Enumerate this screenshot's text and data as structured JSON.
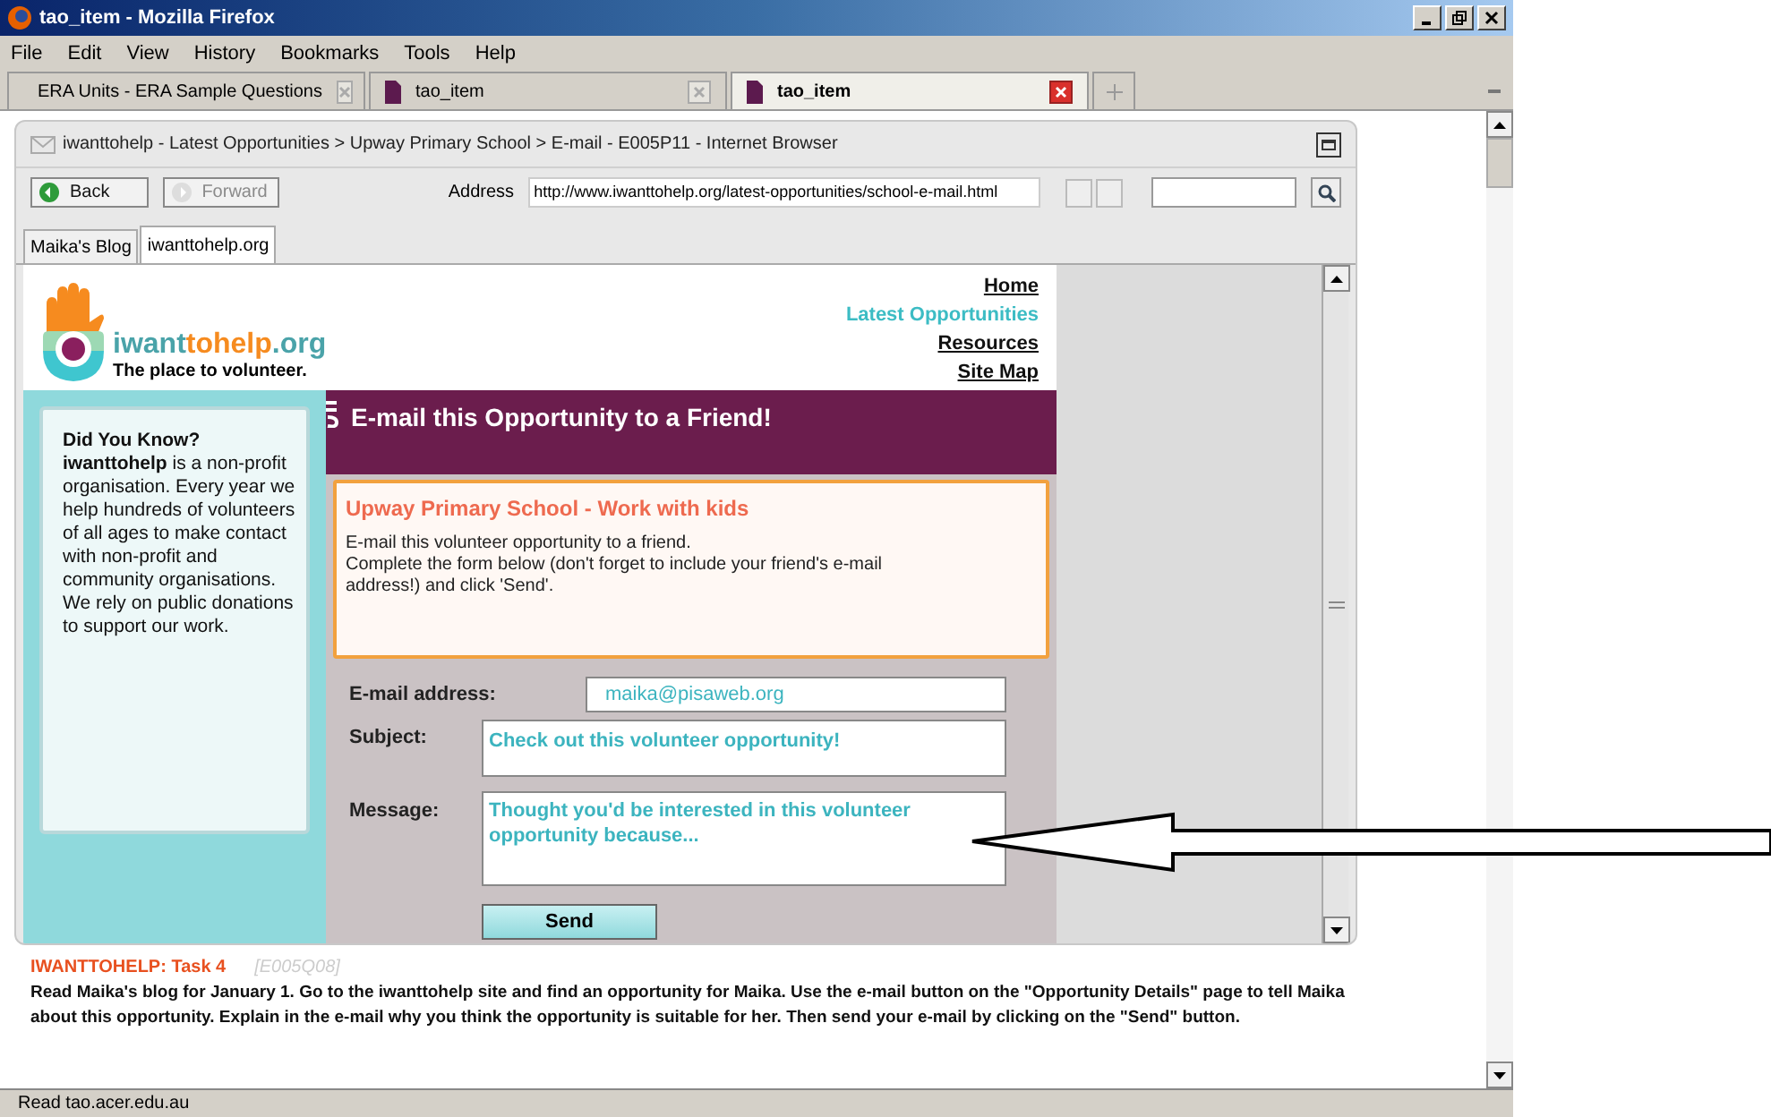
{
  "window": {
    "title": "tao_item - Mozilla Firefox"
  },
  "menu": [
    "File",
    "Edit",
    "View",
    "History",
    "Bookmarks",
    "Tools",
    "Help"
  ],
  "tabs": [
    {
      "label": "ERA Units - ERA Sample Questions",
      "selected": false
    },
    {
      "label": "tao_item",
      "selected": false
    },
    {
      "label": "tao_item",
      "selected": true
    }
  ],
  "inner_browser": {
    "title": "iwanttohelp - Latest Opportunities > Upway Primary School > E-mail - E005P11 - Internet Browser",
    "back": {
      "label": "Back",
      "disabled": false
    },
    "forward": {
      "label": "Forward",
      "disabled": true
    },
    "address_label": "Address",
    "address": "http://www.iwanttohelp.org/latest-opportunities/school-e-mail.html",
    "tabs": [
      {
        "label": "Maika's Blog",
        "selected": false
      },
      {
        "label": "iwanttohelp.org",
        "selected": true
      }
    ]
  },
  "site": {
    "logo": [
      "iwant",
      "tohelp",
      ".org"
    ],
    "tagline": "The place to volunteer.",
    "nav": [
      {
        "label": "Home",
        "selected": false
      },
      {
        "label": "Latest Opportunities",
        "selected": true
      },
      {
        "label": "Resources",
        "selected": false
      },
      {
        "label": "Site Map",
        "selected": false
      }
    ],
    "did_you_know": {
      "title": "Did You Know?",
      "text": "**iwanttohelp** is a non-profit organisation. Every year we help hundreds of volunteers of all ages to make contact with non-profit and community organisations. We rely on public donations to support our work."
    },
    "banner": "E-mail this Opportunity to a Friend!",
    "opportunity": {
      "title": "Upway Primary School - Work with kids",
      "lines": [
        "E-mail this volunteer opportunity to a friend.",
        "Complete the form below (don't forget to include your friend's e-mail address!) and click 'Send'."
      ]
    },
    "form": [
      {
        "kind": "line",
        "label": "E-mail address:",
        "value": "maika@pisaweb.org"
      },
      {
        "kind": "box",
        "label": "Subject:",
        "value": "Check out this volunteer opportunity!"
      },
      {
        "kind": "area",
        "label": "Message:",
        "value": "Thought you'd be interested in this volunteer opportunity because..."
      }
    ],
    "send": "Send"
  },
  "task": {
    "title": "IWANTTOHELP: Task 4",
    "code": "[E005Q08]",
    "text": "Read Maika's blog for January 1. Go to the iwanttohelp site and find an opportunity for Maika. Use the e-mail button on the \"Opportunity Details\" page to tell Maika about this opportunity. Explain in the e-mail why you think the opportunity is suitable for her. Then send your e-mail by clicking on the \"Send\" button."
  },
  "status_bar": "Read tao.acer.edu.au"
}
